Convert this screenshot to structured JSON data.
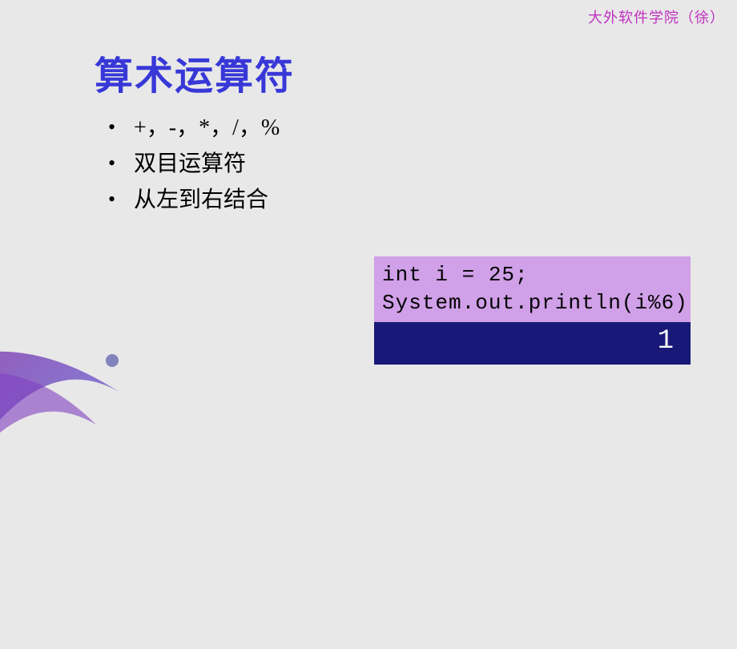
{
  "header": {
    "credit": "大外软件学院（徐）"
  },
  "slide": {
    "title": "算术运算符",
    "bullets": [
      "+，-，*，/，%",
      "双目运算符",
      "从左到右结合"
    ]
  },
  "code": {
    "line1": "int i = 25;",
    "line2": "System.out.println(i%6)",
    "output": "1"
  }
}
